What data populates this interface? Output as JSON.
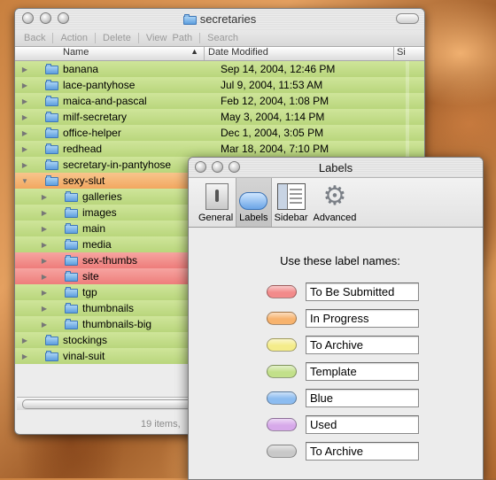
{
  "finder": {
    "title": "secretaries",
    "toolbar": [
      "Back",
      "Action",
      "Delete",
      "View",
      "Path",
      "Search"
    ],
    "columns": {
      "name": "Name",
      "date": "Date Modified",
      "size": "Si"
    },
    "rows": [
      {
        "name": "banana",
        "date": "Sep 14, 2004, 12:46 PM"
      },
      {
        "name": "lace-pantyhose",
        "date": "Jul 9, 2004, 11:53 AM"
      },
      {
        "name": "maica-and-pascal",
        "date": "Feb 12, 2004, 1:08 PM"
      },
      {
        "name": "milf-secretary",
        "date": "May 3, 2004, 1:14 PM"
      },
      {
        "name": "office-helper",
        "date": "Dec 1, 2004, 3:05 PM"
      },
      {
        "name": "redhead",
        "date": "Mar 18, 2004, 7:10 PM"
      },
      {
        "name": "secretary-in-pantyhose",
        "date": ""
      },
      {
        "name": "sexy-slut",
        "date": ""
      },
      {
        "name": "galleries",
        "date": ""
      },
      {
        "name": "images",
        "date": ""
      },
      {
        "name": "main",
        "date": ""
      },
      {
        "name": "media",
        "date": ""
      },
      {
        "name": "sex-thumbs",
        "date": ""
      },
      {
        "name": "site",
        "date": ""
      },
      {
        "name": "tgp",
        "date": ""
      },
      {
        "name": "thumbnails",
        "date": ""
      },
      {
        "name": "thumbnails-big",
        "date": ""
      },
      {
        "name": "stockings",
        "date": ""
      },
      {
        "name": "vinal-suit",
        "date": ""
      }
    ],
    "status": "19 items,"
  },
  "prefs": {
    "title": "Labels",
    "tabs": {
      "general": "General",
      "labels": "Labels",
      "sidebar": "Sidebar",
      "advanced": "Advanced"
    },
    "heading": "Use these label names:",
    "labels": [
      {
        "name": "To Be Submitted",
        "color": "#f28a8a"
      },
      {
        "name": "In Progress",
        "color": "#f7b36e"
      },
      {
        "name": "To Archive",
        "color": "#f4ec8a"
      },
      {
        "name": "Template",
        "color": "#c2e08a"
      },
      {
        "name": "Blue",
        "color": "#8cbcf0"
      },
      {
        "name": "Used",
        "color": "#d7a9ea"
      },
      {
        "name": "To Archive",
        "color": "#c8c8c8"
      }
    ]
  }
}
